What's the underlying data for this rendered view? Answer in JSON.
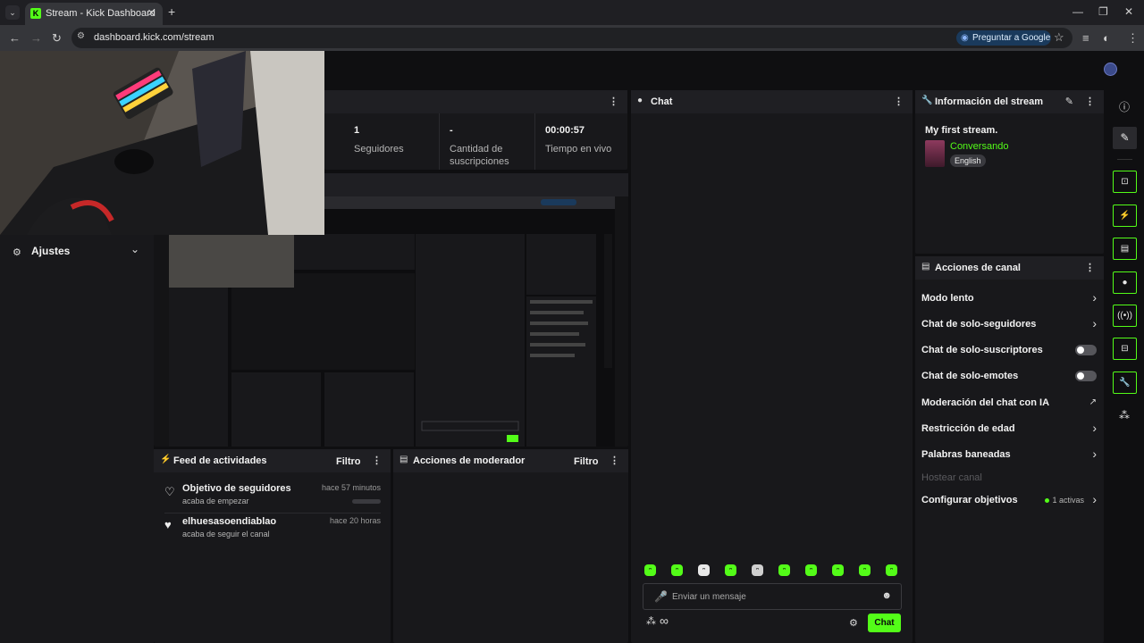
{
  "browser": {
    "tab_title": "Stream - Kick Dashboard",
    "url": "dashboard.kick.com/stream",
    "ask_google": "Preguntar a Google"
  },
  "sidebar": {
    "settings_label": "Ajustes"
  },
  "stats": [
    {
      "value": "1",
      "label": "Seguidores"
    },
    {
      "value": "-",
      "label": "Cantidad de suscripciones"
    },
    {
      "value": "00:00:57",
      "label": "Tiempo en vivo"
    }
  ],
  "feed": {
    "title": "Feed de actividades",
    "filter": "Filtro",
    "items": [
      {
        "title": "Objetivo de seguidores",
        "subtitle": "acaba de empezar",
        "time": "hace 57 minutos",
        "icon": "heart-outline-icon"
      },
      {
        "title": "elhuesasoendiablao",
        "subtitle": "acaba de seguir el canal",
        "time": "hace 20 horas",
        "icon": "heart-filled-icon"
      }
    ]
  },
  "mod_actions": {
    "title": "Acciones de moderador",
    "filter": "Filtro"
  },
  "chat": {
    "title": "Chat",
    "placeholder": "Enviar un mensaje",
    "send_label": "Chat"
  },
  "stream_info": {
    "title": "Información del stream",
    "stream_name": "My first stream.",
    "category": "Conversando",
    "language": "English"
  },
  "channel_actions": {
    "title": "Acciones de canal",
    "items": [
      {
        "label": "Modo lento",
        "control": "chevron"
      },
      {
        "label": "Chat de solo-seguidores",
        "control": "chevron"
      },
      {
        "label": "Chat de solo-suscriptores",
        "control": "toggle-off"
      },
      {
        "label": "Chat de solo-emotes",
        "control": "toggle-off"
      },
      {
        "label": "Moderación del chat con IA",
        "control": "external"
      },
      {
        "label": "Restricción de edad",
        "control": "chevron"
      },
      {
        "label": "Palabras baneadas",
        "control": "chevron"
      },
      {
        "label": "Hostear canal",
        "control": "disabled"
      },
      {
        "label": "Configurar objetivos",
        "control": "chevron",
        "badge": "1 activas"
      }
    ]
  },
  "colors": {
    "accent": "#53fc18",
    "panel": "#18181b",
    "background": "#0f0f11"
  }
}
